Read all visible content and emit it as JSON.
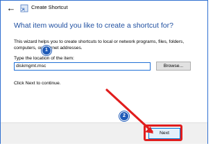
{
  "window": {
    "title": "Create Shortcut",
    "back_icon": "back-arrow-icon",
    "app_icon": "shortcut-icon"
  },
  "main": {
    "heading": "What item would you like to create a shortcut for?",
    "description": "This wizard helps you to create shortcuts to local or network programs, files, folders, computers, or Internet addresses.",
    "location_label": "Type the location of the item:",
    "location_value": "diskmgmt.msc",
    "browse_label": "Browse...",
    "continue_text": "Click Next to continue."
  },
  "footer": {
    "next_label": "Next"
  },
  "annotations": {
    "step1": "1",
    "step2": "2",
    "accent_color": "#1f5bb8",
    "highlight_color": "#e11d1d"
  }
}
